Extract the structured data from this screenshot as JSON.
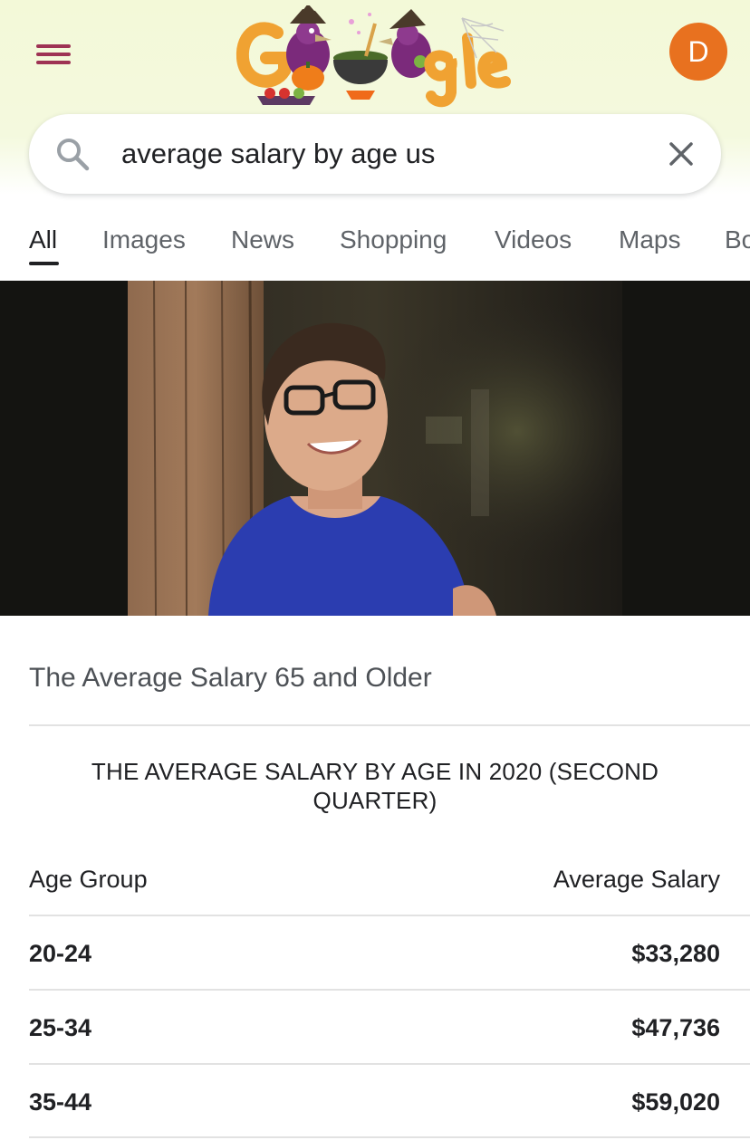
{
  "header": {
    "avatar_letter": "D",
    "doodle_icon": "halloween-doodle-logo",
    "colors": {
      "menu": "#9e3354",
      "avatar": "#e8711f",
      "doodle_orange": "#f0a232"
    }
  },
  "search": {
    "query": "average salary by age us"
  },
  "tabs": [
    {
      "label": "All",
      "active": true
    },
    {
      "label": "Images"
    },
    {
      "label": "News"
    },
    {
      "label": "Shopping"
    },
    {
      "label": "Videos"
    },
    {
      "label": "Maps"
    },
    {
      "label": "Bo"
    }
  ],
  "result": {
    "title": "The Average Salary 65 and Older",
    "table": {
      "title": "THE AVERAGE SALARY BY AGE IN 2020 (SECOND QUARTER)",
      "columns": [
        "Age Group",
        "Average Salary"
      ],
      "rows": [
        {
          "age": "20-24",
          "salary": "$33,280"
        },
        {
          "age": "25-34",
          "salary": "$47,736"
        },
        {
          "age": "35-44",
          "salary": "$59,020"
        }
      ]
    }
  }
}
